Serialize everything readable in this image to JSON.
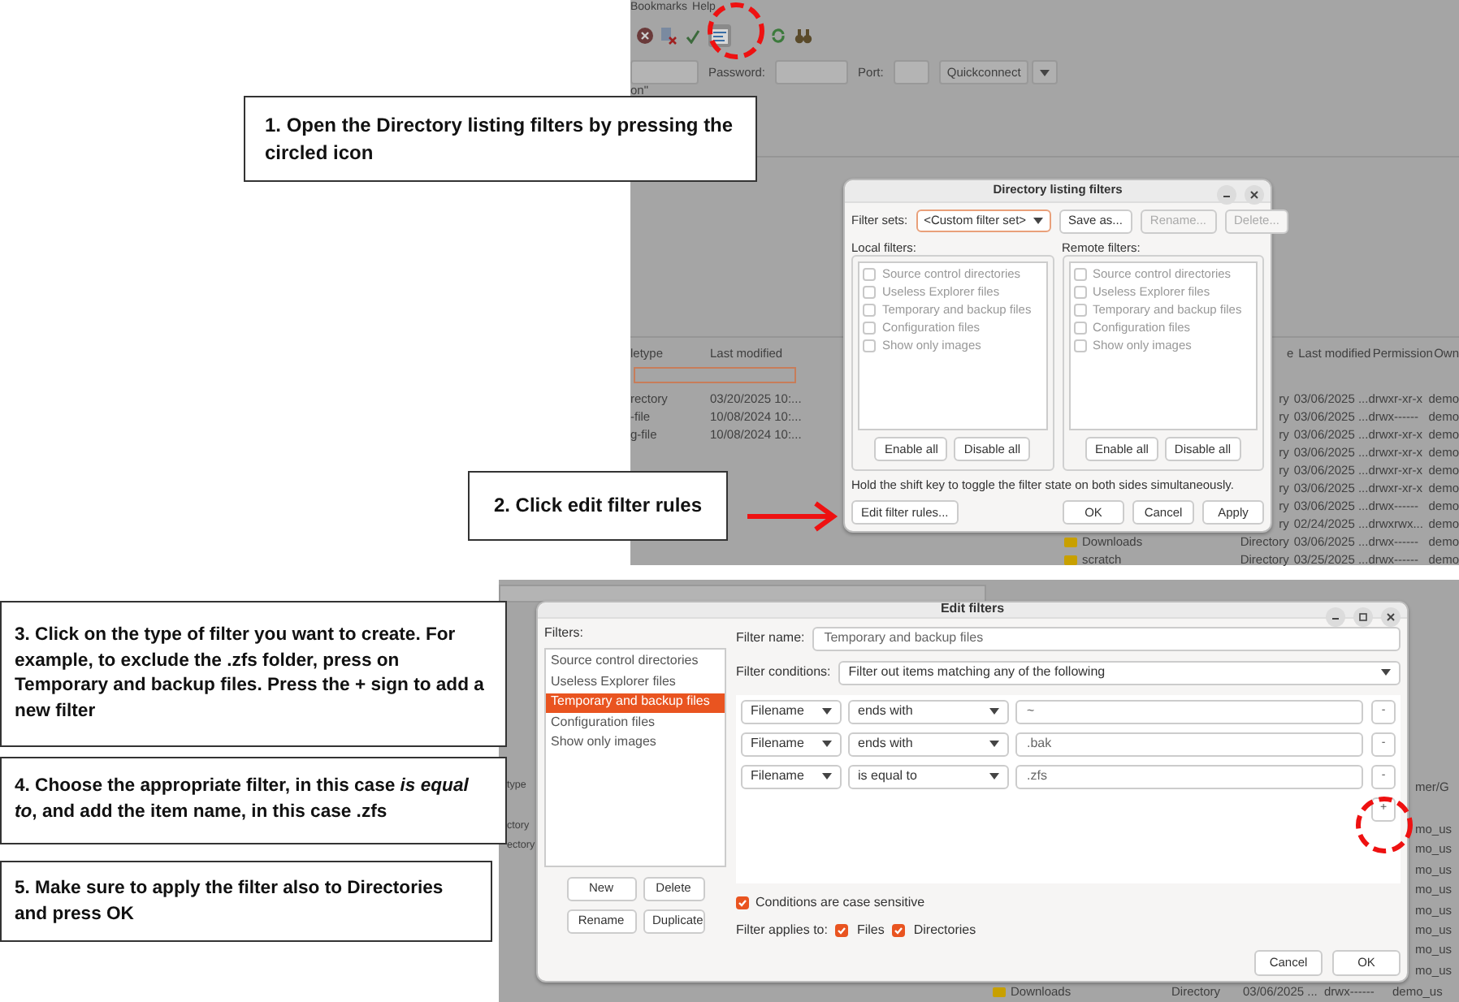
{
  "top_screenshot": {
    "menu": [
      "Bookmarks",
      "Help"
    ],
    "toolbar": {
      "filter_button_pressed": true
    },
    "quickconnect": {
      "password_label": "Password:",
      "port_label": "Port:",
      "button": "Quickconnect"
    },
    "log_fragment": "on\"",
    "local_list": {
      "columns": [
        "letype",
        "Last modified"
      ],
      "rows": [
        [
          "rectory",
          "03/20/2025 10:..."
        ],
        [
          "-file",
          "10/08/2024 10:..."
        ],
        [
          "g-file",
          "10/08/2024 10:..."
        ]
      ]
    },
    "remote_list": {
      "columns": [
        "e",
        "Last modified",
        "Permission",
        "Own"
      ],
      "rows": [
        {
          "type": "ry",
          "modified": "03/06/2025 ...",
          "permissions": "drwxr-xr-x",
          "owner": "demo"
        },
        {
          "type": "ry",
          "modified": "03/06/2025 ...",
          "permissions": "drwx------",
          "owner": "demo"
        },
        {
          "type": "ry",
          "modified": "03/06/2025 ...",
          "permissions": "drwxr-xr-x",
          "owner": "demo"
        },
        {
          "type": "ry",
          "modified": "03/06/2025 ...",
          "permissions": "drwxr-xr-x",
          "owner": "demo"
        },
        {
          "type": "ry",
          "modified": "03/06/2025 ...",
          "permissions": "drwxr-xr-x",
          "owner": "demo"
        },
        {
          "type": "ry",
          "modified": "03/06/2025 ...",
          "permissions": "drwxr-xr-x",
          "owner": "demo"
        },
        {
          "type": "ry",
          "modified": "03/06/2025 ...",
          "permissions": "drwx------",
          "owner": "demo"
        },
        {
          "type": "ry",
          "modified": "02/24/2025 ...",
          "permissions": "drwxrwx...",
          "owner": "demo"
        },
        {
          "name": "Downloads",
          "type": "Directory",
          "modified": "03/06/2025 ...",
          "permissions": "drwx------",
          "owner": "demo"
        },
        {
          "name": "scratch",
          "type": "Directory",
          "modified": "03/25/2025 ...",
          "permissions": "drwx------",
          "owner": "demo"
        }
      ]
    }
  },
  "directory_filters_dialog": {
    "title": "Directory listing filters",
    "filter_sets_label": "Filter sets:",
    "filter_set": "<Custom filter set>",
    "set_buttons": [
      {
        "label": "Save as...",
        "disabled": false
      },
      {
        "label": "Rename...",
        "disabled": true
      },
      {
        "label": "Delete...",
        "disabled": true
      }
    ],
    "panes": [
      {
        "label": "Local filters:",
        "items": [
          {
            "label": "Source control directories",
            "checked": false
          },
          {
            "label": "Useless Explorer files",
            "checked": false
          },
          {
            "label": "Temporary and backup files",
            "checked": false
          },
          {
            "label": "Configuration files",
            "checked": false
          },
          {
            "label": "Show only images",
            "checked": false
          }
        ],
        "buttons": [
          "Enable all",
          "Disable all"
        ]
      },
      {
        "label": "Remote filters:",
        "items": [
          {
            "label": "Source control directories",
            "checked": false
          },
          {
            "label": "Useless Explorer files",
            "checked": false
          },
          {
            "label": "Temporary and backup files",
            "checked": false
          },
          {
            "label": "Configuration files",
            "checked": false
          },
          {
            "label": "Show only images",
            "checked": false
          }
        ],
        "buttons": [
          "Enable all",
          "Disable all"
        ]
      }
    ],
    "hint": "Hold the shift key to toggle the filter state on both sides simultaneously.",
    "edit_button": "Edit filter rules...",
    "buttons": [
      "OK",
      "Cancel",
      "Apply"
    ]
  },
  "callouts": [
    {
      "text": "1. Open the Directory listing filters by pressing the circled icon"
    },
    {
      "text": "2. Click edit filter rules"
    },
    {
      "text": "3. Click on the type of filter you want to create. For example, to exclude the .zfs folder, press on Temporary and backup files. Press the + sign to add a new filter"
    },
    {
      "text": "4. Choose the appropriate filter, in this case *is equal to*, and add the item name, in this case .zfs"
    },
    {
      "text": "5. Make sure to apply the filter also to Directories and press OK"
    }
  ],
  "bottom_screenshot": {
    "local_fragments": [
      "type",
      "ctory",
      "ectory"
    ],
    "remote_header": "mer/G",
    "remote_owner_fragments": [
      "mo_us",
      "mo_us",
      "mo_us",
      "mo_us",
      "mo_us",
      "mo_us",
      "mo_us",
      "mo_us"
    ],
    "bottom_row": {
      "name": "Downloads",
      "type": "Directory",
      "modified": "03/06/2025 ...",
      "permissions": "drwx------",
      "owner": "demo_us"
    }
  },
  "edit_filters_dialog": {
    "title": "Edit filters",
    "filters_label": "Filters:",
    "filters": [
      {
        "label": "Source control directories",
        "selected": false
      },
      {
        "label": "Useless Explorer files",
        "selected": false
      },
      {
        "label": "Temporary and backup files",
        "selected": true
      },
      {
        "label": "Configuration files",
        "selected": false
      },
      {
        "label": "Show only images",
        "selected": false
      }
    ],
    "list_buttons": [
      "New",
      "Delete",
      "Rename",
      "Duplicate"
    ],
    "filter_name_label": "Filter name:",
    "filter_name": "Temporary and backup files",
    "conditions_label": "Filter conditions:",
    "conditions_mode": "Filter out items matching any of the following",
    "conditions": [
      {
        "field": "Filename",
        "operator": "ends with",
        "value": "~",
        "remove": "-"
      },
      {
        "field": "Filename",
        "operator": "ends with",
        "value": ".bak",
        "remove": "-"
      },
      {
        "field": "Filename",
        "operator": "is equal to",
        "value": ".zfs",
        "remove": "-"
      }
    ],
    "add_button": "+",
    "case_sensitive": {
      "label": "Conditions are case sensitive",
      "checked": true
    },
    "applies_label": "Filter applies to:",
    "applies": [
      {
        "label": "Files",
        "checked": true
      },
      {
        "label": "Directories",
        "checked": true
      }
    ],
    "buttons": [
      "Cancel",
      "OK"
    ]
  }
}
